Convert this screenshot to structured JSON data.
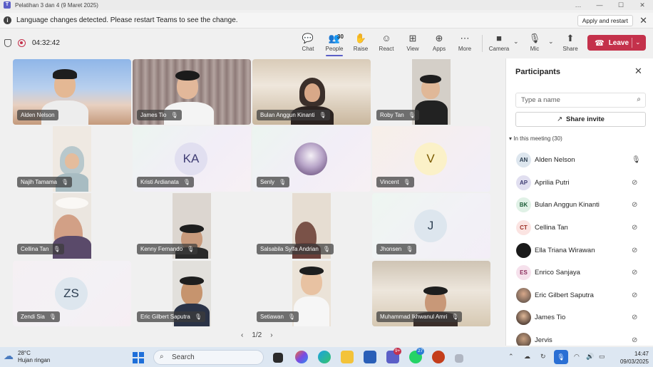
{
  "window": {
    "title": "Pelatihan 3 dan 4 (9 Maret 2025)",
    "controls": [
      "…",
      "—",
      "☐",
      "✕"
    ]
  },
  "notification": {
    "text": "Language changes detected. Please restart Teams to see the change.",
    "button": "Apply and restart"
  },
  "toolbar": {
    "timer": "04:32:42",
    "people_count": "30",
    "buttons": [
      {
        "label": "Chat",
        "icon": "chat-icon"
      },
      {
        "label": "People",
        "icon": "people-icon"
      },
      {
        "label": "Raise",
        "icon": "raise-hand-icon"
      },
      {
        "label": "React",
        "icon": "react-icon"
      },
      {
        "label": "View",
        "icon": "view-icon"
      },
      {
        "label": "Apps",
        "icon": "apps-icon"
      },
      {
        "label": "More",
        "icon": "more-icon"
      },
      {
        "label": "Camera",
        "icon": "camera-icon"
      },
      {
        "label": "Mic",
        "icon": "mic-icon"
      },
      {
        "label": "Share",
        "icon": "share-icon"
      }
    ],
    "leave_label": "Leave"
  },
  "grid": {
    "tiles": [
      {
        "name": "Alden Nelson"
      },
      {
        "name": "James Tio"
      },
      {
        "name": "Bulan Anggun Kinanti"
      },
      {
        "name": "Roby Tan"
      },
      {
        "name": "Najih Tamama"
      },
      {
        "name": "Kristi Ardianata",
        "initials": "KA"
      },
      {
        "name": "Senly"
      },
      {
        "name": "Vincent",
        "initials": "V"
      },
      {
        "name": "Cellina Tan"
      },
      {
        "name": "Kenny Fernando"
      },
      {
        "name": "Salsabila Sylfa Andrian"
      },
      {
        "name": "Jhonsen",
        "initials": "J"
      },
      {
        "name": "Zendi Sia",
        "initials": "ZS"
      },
      {
        "name": "Eric Gilbert Saputra"
      },
      {
        "name": "Setiawan"
      },
      {
        "name": "Muhammad Ikhwanul Amri"
      }
    ],
    "pager": "1/2"
  },
  "panel": {
    "title": "Participants",
    "search_placeholder": "Type a name",
    "share_invite": "Share invite",
    "section_label": "In this meeting (30)",
    "participants": [
      {
        "name": "Alden Nelson",
        "initials": "AN",
        "mic": "on"
      },
      {
        "name": "Aprilia Putri",
        "initials": "AP",
        "mic": "muted"
      },
      {
        "name": "Bulan Anggun Kinanti",
        "initials": "BK",
        "mic": "muted"
      },
      {
        "name": "Cellina Tan",
        "initials": "CT",
        "mic": "muted"
      },
      {
        "name": "Ella Triana Wirawan",
        "initials": "",
        "mic": "muted"
      },
      {
        "name": "Enrico Sanjaya",
        "initials": "ES",
        "mic": "muted"
      },
      {
        "name": "Eric Gilbert Saputra",
        "initials": "",
        "mic": "muted"
      },
      {
        "name": "James Tio",
        "initials": "",
        "mic": "muted"
      },
      {
        "name": "Jervis",
        "initials": "",
        "mic": "muted"
      }
    ]
  },
  "taskbar": {
    "weather_temp": "28°C",
    "weather_desc": "Hujan ringan",
    "search_label": "Search",
    "badge_teams": "9+",
    "badge_whatsapp": "27",
    "time": "14:47",
    "date": "09/03/2025"
  }
}
